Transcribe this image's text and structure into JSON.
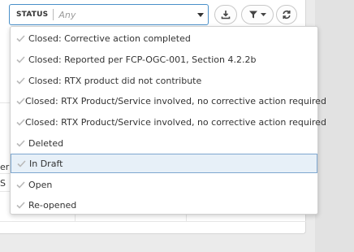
{
  "filter": {
    "label": "STATUS",
    "placeholder": "Any"
  },
  "toolbar": {
    "download_icon": "download-icon",
    "filter_icon": "filter-icon",
    "refresh_icon": "refresh-icon"
  },
  "background": {
    "peek_text_1": "er l",
    "peek_text_2": "S"
  },
  "dropdown": {
    "options": [
      {
        "label": "Closed: Corrective action completed",
        "selected": false
      },
      {
        "label": "Closed: Reported per FCP-OGC-001, Section 4.2.2b",
        "selected": false
      },
      {
        "label": "Closed: RTX product did not contribute",
        "selected": false
      },
      {
        "label": "Closed: RTX Product/Service involved, no corrective action required",
        "selected": false
      },
      {
        "label": "Closed: RTX Product/Service involved, no corrective action required",
        "selected": false
      },
      {
        "label": "Deleted",
        "selected": false
      },
      {
        "label": "In Draft",
        "selected": true
      },
      {
        "label": "Open",
        "selected": false
      },
      {
        "label": "Re-opened",
        "selected": false
      }
    ]
  },
  "colors": {
    "accent": "#4a90c9",
    "check": "#b9b9b9",
    "highlight_bg": "#e7f0f8"
  }
}
